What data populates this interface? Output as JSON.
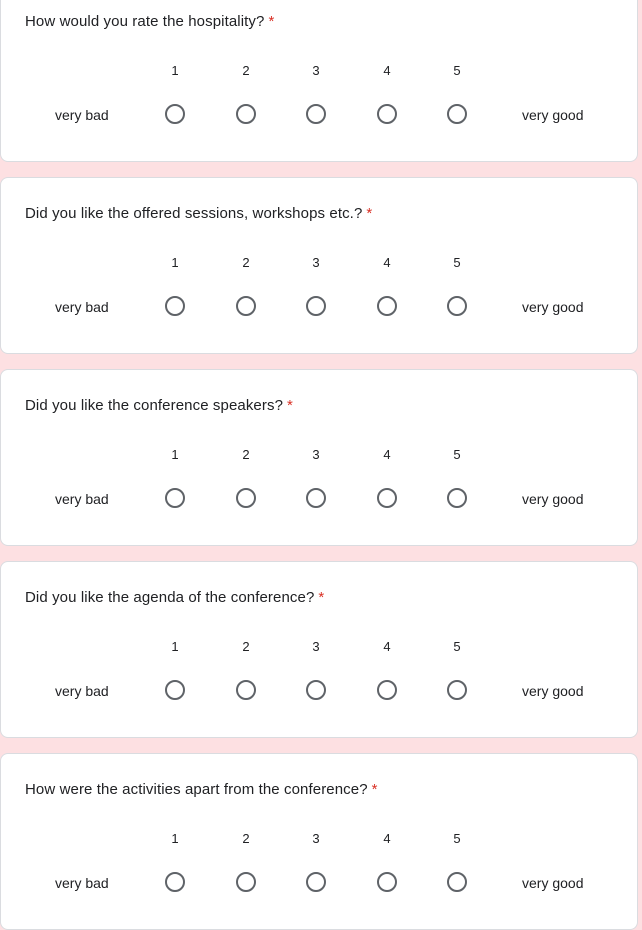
{
  "required_marker": "*",
  "scale": {
    "options": [
      "1",
      "2",
      "3",
      "4",
      "5"
    ],
    "low_label": "very bad",
    "high_label": "very good"
  },
  "questions": [
    {
      "text": "How would you rate the hospitality?"
    },
    {
      "text": "Did you like the offered sessions, workshops etc.?"
    },
    {
      "text": "Did you like the conference speakers?"
    },
    {
      "text": "Did you like the agenda of the conference?"
    },
    {
      "text": "How were the activities apart from the conference?"
    }
  ]
}
